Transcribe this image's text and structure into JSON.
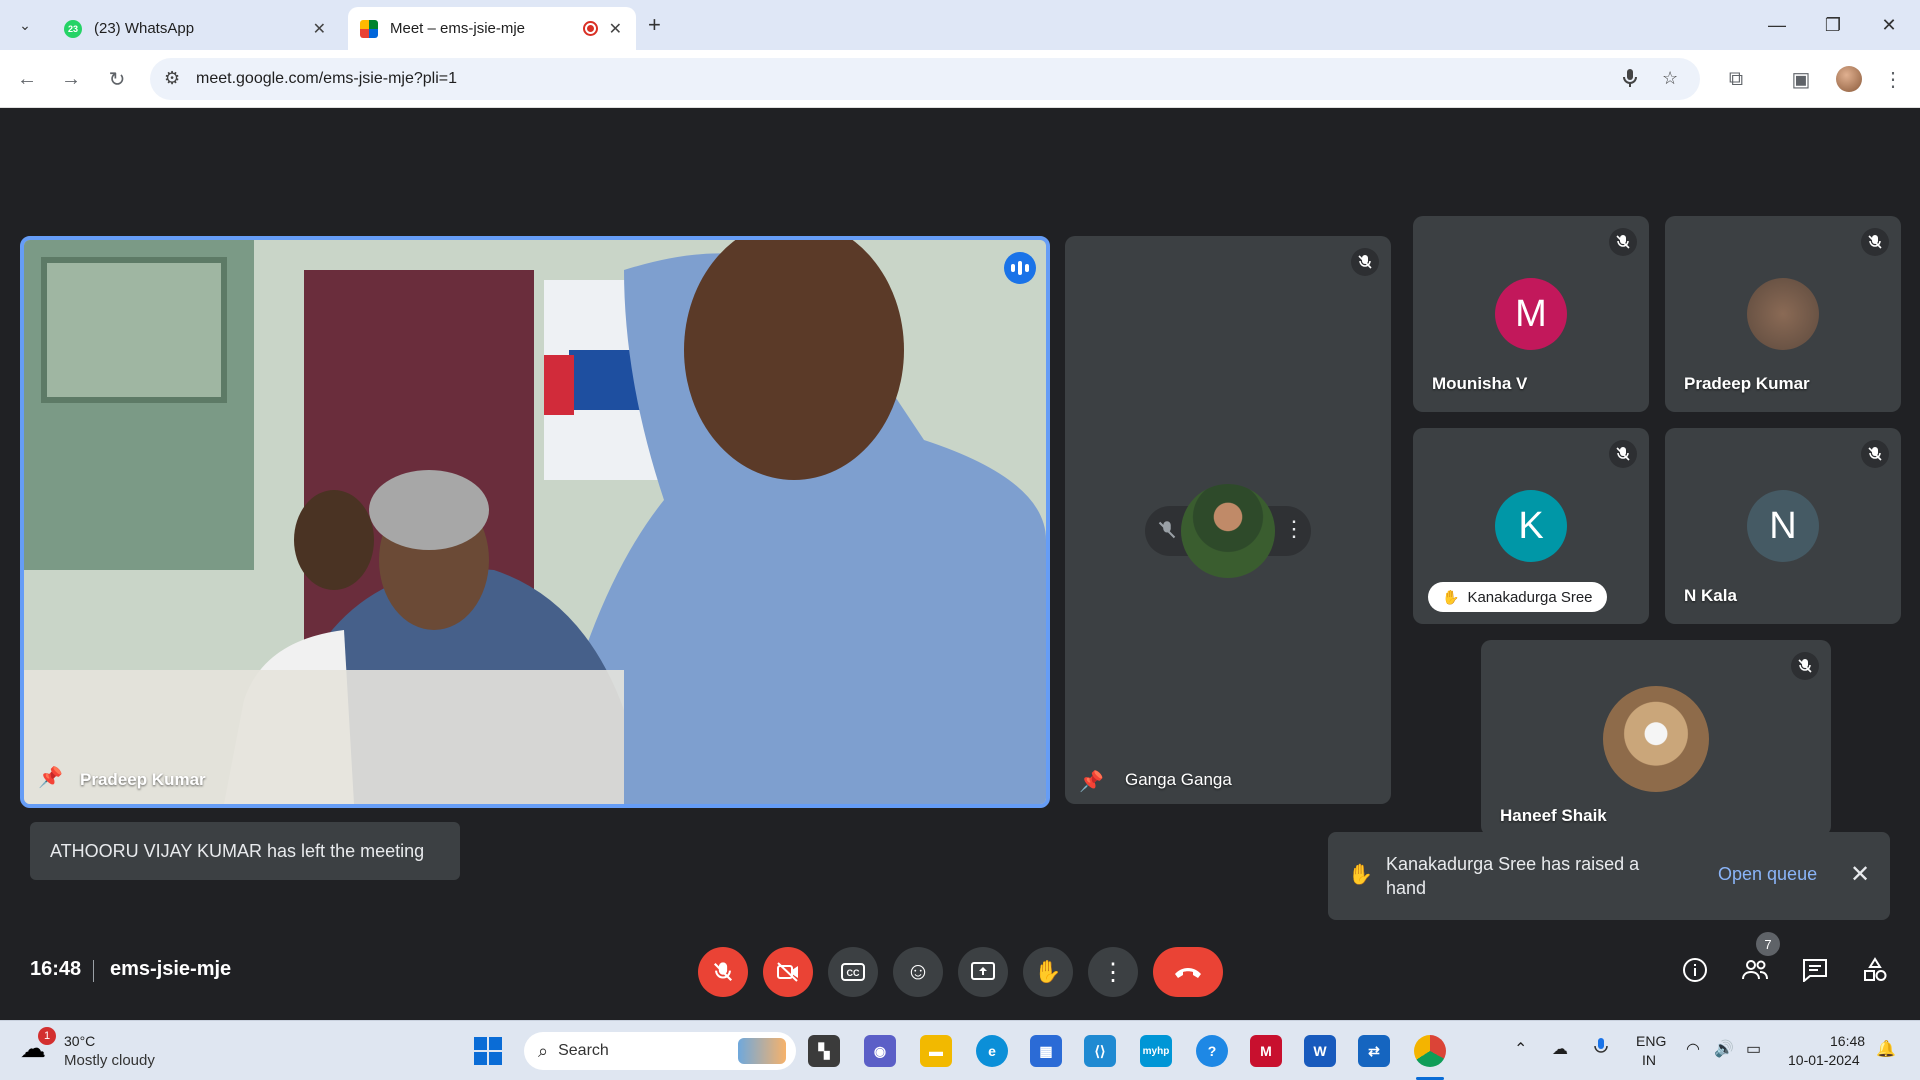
{
  "browser": {
    "tabs": [
      {
        "label": "(23) WhatsApp",
        "badge": "23"
      },
      {
        "label": "Meet – ems-jsie-mje"
      }
    ],
    "new_tab": "+",
    "url": "meet.google.com/ems-jsie-mje?pli=1"
  },
  "meet": {
    "participants": {
      "main": {
        "name": "Pradeep Kumar"
      },
      "ganga": {
        "name": "Ganga Ganga"
      },
      "mounisha": {
        "name": "Mounisha V",
        "initial": "M",
        "color": "#c2185b"
      },
      "pradeep2": {
        "name": "Pradeep Kumar"
      },
      "kanaka": {
        "name": "Kanakadurga Sree",
        "initial": "K",
        "color": "#0097a7"
      },
      "nkala": {
        "name": "N Kala",
        "initial": "N",
        "color": "#455a64"
      },
      "haneef": {
        "name": "Haneef Shaik"
      }
    },
    "left_notice": "ATHOORU VIJAY KUMAR has left the meeting",
    "hand_notice": {
      "text": "Kanakadurga Sree has raised a hand",
      "action": "Open queue"
    },
    "time": "16:48",
    "meeting_code": "ems-jsie-mje",
    "people_count": "7"
  },
  "taskbar": {
    "weather": {
      "temp": "30°C",
      "desc": "Mostly cloudy",
      "badge": "1"
    },
    "search_label": "Search",
    "lang": {
      "line1": "ENG",
      "line2": "IN"
    },
    "clock": {
      "time": "16:48",
      "date": "10-01-2024"
    }
  }
}
